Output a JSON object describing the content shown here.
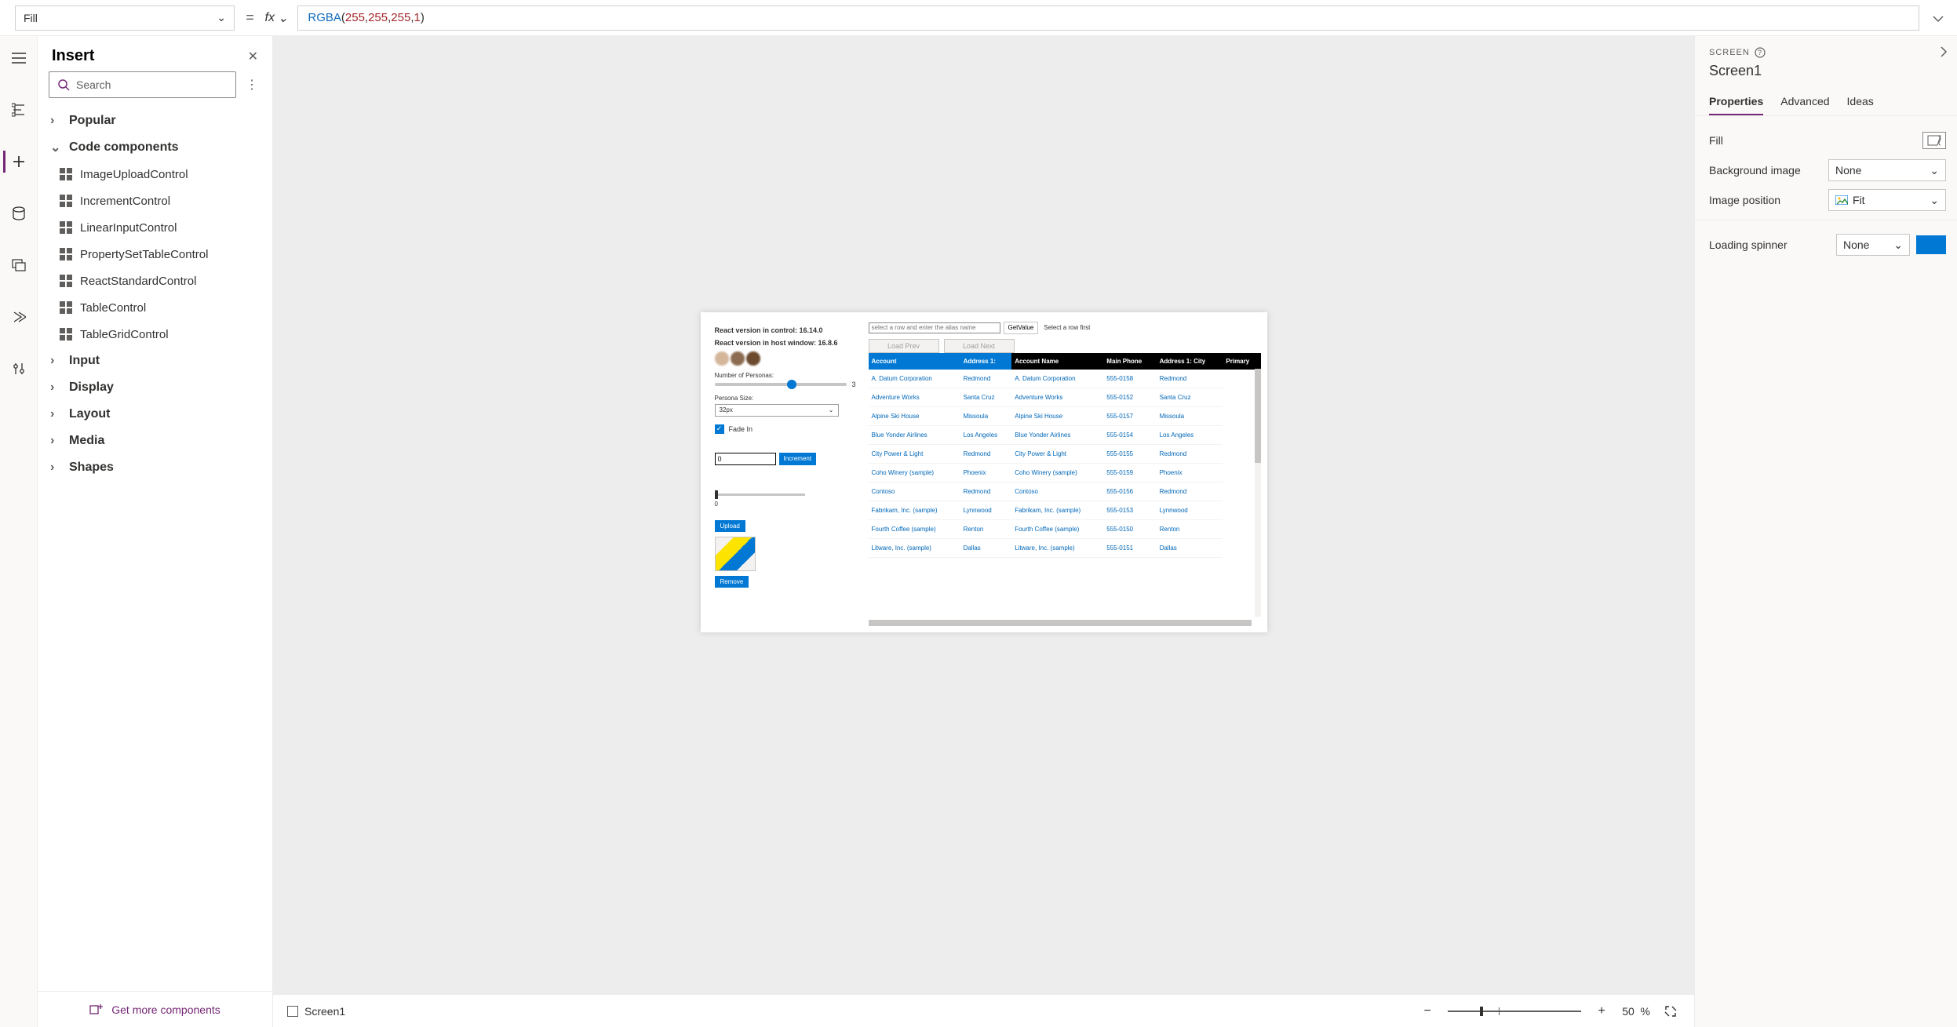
{
  "formula": {
    "property": "Fill",
    "fx": "fx",
    "chevron": "⌄",
    "fn": "RGBA",
    "args": [
      "255",
      "255",
      "255",
      "1"
    ]
  },
  "insert": {
    "title": "Insert",
    "search_placeholder": "Search",
    "groups": {
      "popular": "Popular",
      "code_components": "Code components",
      "input": "Input",
      "display": "Display",
      "layout": "Layout",
      "media": "Media",
      "shapes": "Shapes"
    },
    "code_items": [
      "ImageUploadControl",
      "IncrementControl",
      "LinearInputControl",
      "PropertySetTableControl",
      "ReactStandardControl",
      "TableControl",
      "TableGridControl"
    ],
    "chev_right": "›",
    "chev_down": "⌄",
    "get_more": "Get more components"
  },
  "canvas": {
    "react_control": "React version in control: 16.14.0",
    "react_host": "React version in host window: 16.8.6",
    "num_personas_label": "Number of Personas:",
    "num_personas_value": "3",
    "persona_size_label": "Persona Size:",
    "persona_size_value": "32px",
    "fade_in": "Fade In",
    "inc_value": "0",
    "inc_btn": "Increment",
    "slider_val": "0",
    "upload": "Upload",
    "remove": "Remove",
    "alias_placeholder": "select a row and enter the alias name",
    "get_value": "GetValue",
    "hint": "Select a row first",
    "load_prev": "Load Prev",
    "load_next": "Load Next",
    "headers": [
      "Account",
      "Address 1:",
      "Account Name",
      "Main Phone",
      "Address 1: City",
      "Primary"
    ],
    "rows": [
      [
        "A. Datum Corporation",
        "Redmond",
        "A. Datum Corporation",
        "555-0158",
        "Redmond"
      ],
      [
        "Adventure Works",
        "Santa Cruz",
        "Adventure Works",
        "555-0152",
        "Santa Cruz"
      ],
      [
        "Alpine Ski House",
        "Missoula",
        "Alpine Ski House",
        "555-0157",
        "Missoula"
      ],
      [
        "Blue Yonder Airlines",
        "Los Angeles",
        "Blue Yonder Airlines",
        "555-0154",
        "Los Angeles"
      ],
      [
        "City Power & Light",
        "Redmond",
        "City Power & Light",
        "555-0155",
        "Redmond"
      ],
      [
        "Coho Winery (sample)",
        "Phoenix",
        "Coho Winery (sample)",
        "555-0159",
        "Phoenix"
      ],
      [
        "Contoso",
        "Redmond",
        "Contoso",
        "555-0156",
        "Redmond"
      ],
      [
        "Fabrikam, Inc. (sample)",
        "Lynnwood",
        "Fabrikam, Inc. (sample)",
        "555-0153",
        "Lynnwood"
      ],
      [
        "Fourth Coffee (sample)",
        "Renton",
        "Fourth Coffee (sample)",
        "555-0150",
        "Renton"
      ],
      [
        "Litware, Inc. (sample)",
        "Dallas",
        "Litware, Inc. (sample)",
        "555-0151",
        "Dallas"
      ]
    ]
  },
  "status": {
    "screen": "Screen1",
    "zoom_pct": "50",
    "zoom_unit": "%"
  },
  "right": {
    "kind": "SCREEN",
    "name": "Screen1",
    "tabs": {
      "properties": "Properties",
      "advanced": "Advanced",
      "ideas": "Ideas"
    },
    "rows": {
      "fill": "Fill",
      "bg_image": "Background image",
      "bg_image_val": "None",
      "img_pos": "Image position",
      "img_pos_val": "Fit",
      "spinner": "Loading spinner",
      "spinner_val": "None"
    }
  }
}
